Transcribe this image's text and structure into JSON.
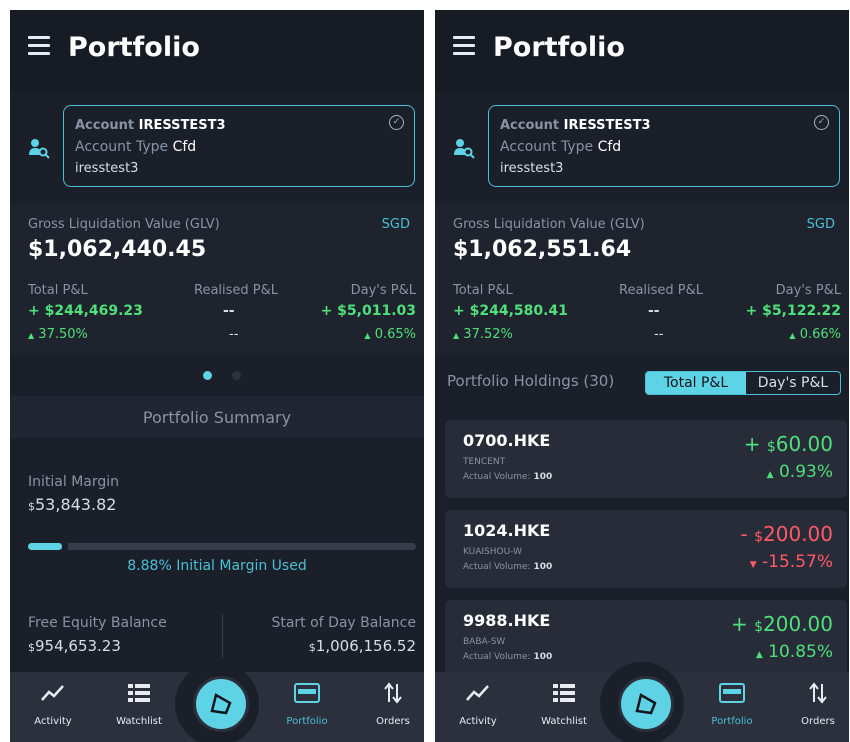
{
  "left": {
    "title": "Portfolio",
    "account": {
      "label": "Account",
      "id": "IRESSTEST3",
      "type_label": "Account Type",
      "type": "Cfd",
      "user": "iresstest3"
    },
    "glv": {
      "label": "Gross Liquidation Value (GLV)",
      "currency": "SGD",
      "value": "$1,062,440.45"
    },
    "pnl": {
      "total_label": "Total P&L",
      "total_value": "+ $244,469.23",
      "total_pct": "37.50%",
      "realised_label": "Realised P&L",
      "realised_value": "--",
      "realised_pct": "--",
      "day_label": "Day's P&L",
      "day_value": "+ $5,011.03",
      "day_pct": "0.65%"
    },
    "summary": {
      "header": "Portfolio Summary",
      "initial_margin_label": "Initial Margin",
      "initial_margin_value": "53,843.82",
      "margin_used": 8.88,
      "margin_used_text": "8.88% Initial Margin Used",
      "free_equity_label": "Free Equity Balance",
      "free_equity_value": "954,653.23",
      "sod_label": "Start of Day Balance",
      "sod_value": "1,006,156.52"
    }
  },
  "right": {
    "title": "Portfolio",
    "account": {
      "label": "Account",
      "id": "IRESSTEST3",
      "type_label": "Account Type",
      "type": "Cfd",
      "user": "iresstest3"
    },
    "glv": {
      "label": "Gross Liquidation Value (GLV)",
      "currency": "SGD",
      "value": "$1,062,551.64"
    },
    "pnl": {
      "total_label": "Total P&L",
      "total_value": "+ $244,580.41",
      "total_pct": "37.52%",
      "realised_label": "Realised P&L",
      "realised_value": "--",
      "realised_pct": "--",
      "day_label": "Day's P&L",
      "day_value": "+ $5,122.22",
      "day_pct": "0.66%"
    },
    "holdings_title": "Portfolio Holdings (30)",
    "toggle": {
      "active": "Total P&L",
      "inactive": "Day's P&L"
    },
    "holdings": [
      {
        "code": "0700.HKE",
        "name": "TENCENT",
        "volume_label": "Actual Volume:",
        "volume": "100",
        "sign": "+",
        "amount": "60.00",
        "pct": "0.93%",
        "direction": "up"
      },
      {
        "code": "1024.HKE",
        "name": "KUAISHOU-W",
        "volume_label": "Actual Volume:",
        "volume": "100",
        "sign": "-",
        "amount": "200.00",
        "pct": "-15.57%",
        "direction": "down"
      },
      {
        "code": "9988.HKE",
        "name": "BABA-SW",
        "volume_label": "Actual Volume:",
        "volume": "100",
        "sign": "+",
        "amount": "200.00",
        "pct": "10.85%",
        "direction": "up"
      }
    ]
  },
  "currency_symbol": "$",
  "up_arrow": "▲",
  "down_arrow": "▼",
  "check_glyph": "✓",
  "nav": {
    "activity": "Activity",
    "watchlist": "Watchlist",
    "portfolio": "Portfolio",
    "orders": "Orders"
  },
  "colors": {
    "accent": "#5fd3e6",
    "positive": "#4ee07a",
    "negative": "#ff5a66",
    "background": "#1b1f29"
  }
}
